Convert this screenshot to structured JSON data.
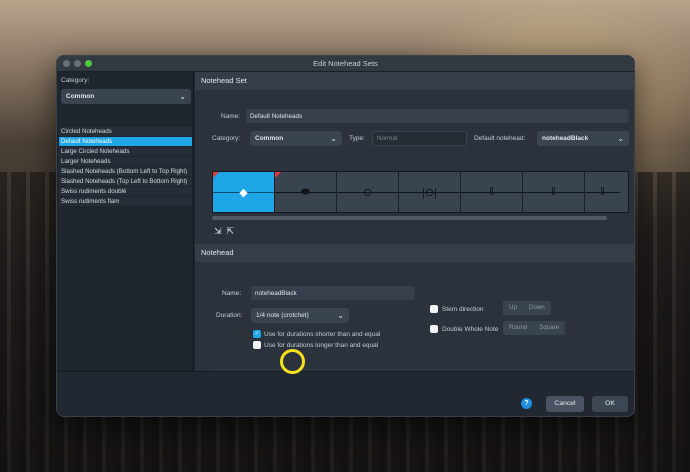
{
  "window": {
    "title": "Edit Notehead Sets"
  },
  "left": {
    "category_label": "Category:",
    "category_value": "Common",
    "items": [
      "Circled Noteheads",
      "Default Noteheads",
      "Large Circled Noteheads",
      "Larger Noteheads",
      "Slashed Noteheads (Bottom Left to Top Right)",
      "Slashed Noteheads (Top Left to Bottom Right)",
      "Swiss rudiments doublé",
      "Swiss rudiments flam"
    ],
    "selected_index": 1,
    "toolbar_icons": [
      "add-icon",
      "duplicate-icon",
      "star-icon",
      "revert-icon",
      "delete-icon"
    ]
  },
  "set": {
    "header": "Notehead Set",
    "name_label": "Name:",
    "name_value": "Default Noteheads",
    "category_label": "Category:",
    "category_value": "Common",
    "type_label": "Type:",
    "type_placeholder": "Normal",
    "default_label": "Default notehead:",
    "default_value": "noteheadBlack",
    "glyphs": [
      "◆",
      "⬬",
      "⊖",
      "|⊖|",
      "‖",
      "‖",
      "‖"
    ],
    "toolbar_icons": [
      "import-icon",
      "export-icon"
    ]
  },
  "notehead": {
    "header": "Notehead",
    "name_label": "Name:",
    "name_value": "noteheadBlack",
    "duration_label": "Duration:",
    "duration_value": "1/4 note (crotchet)",
    "shorter_label": "Use for durations shorter than and equal",
    "longer_label": "Use for durations longer than and equal",
    "shorter_checked": true,
    "longer_checked": false,
    "stem_label": "Stem direction",
    "stem_up": "Up",
    "stem_down": "Down",
    "double_label": "Double Whole Note",
    "double_round": "Round",
    "double_square": "Square",
    "toolbar_icons": [
      "add-icon",
      "duplicate-icon",
      "edit-icon",
      "star-icon",
      "revert-icon",
      "delete-icon"
    ]
  },
  "footer": {
    "help": "?",
    "cancel": "Cancel",
    "ok": "OK"
  },
  "colors": {
    "accent": "#1ea6e6",
    "highlight": "#f5e21c",
    "marker": "#e23b3b"
  }
}
